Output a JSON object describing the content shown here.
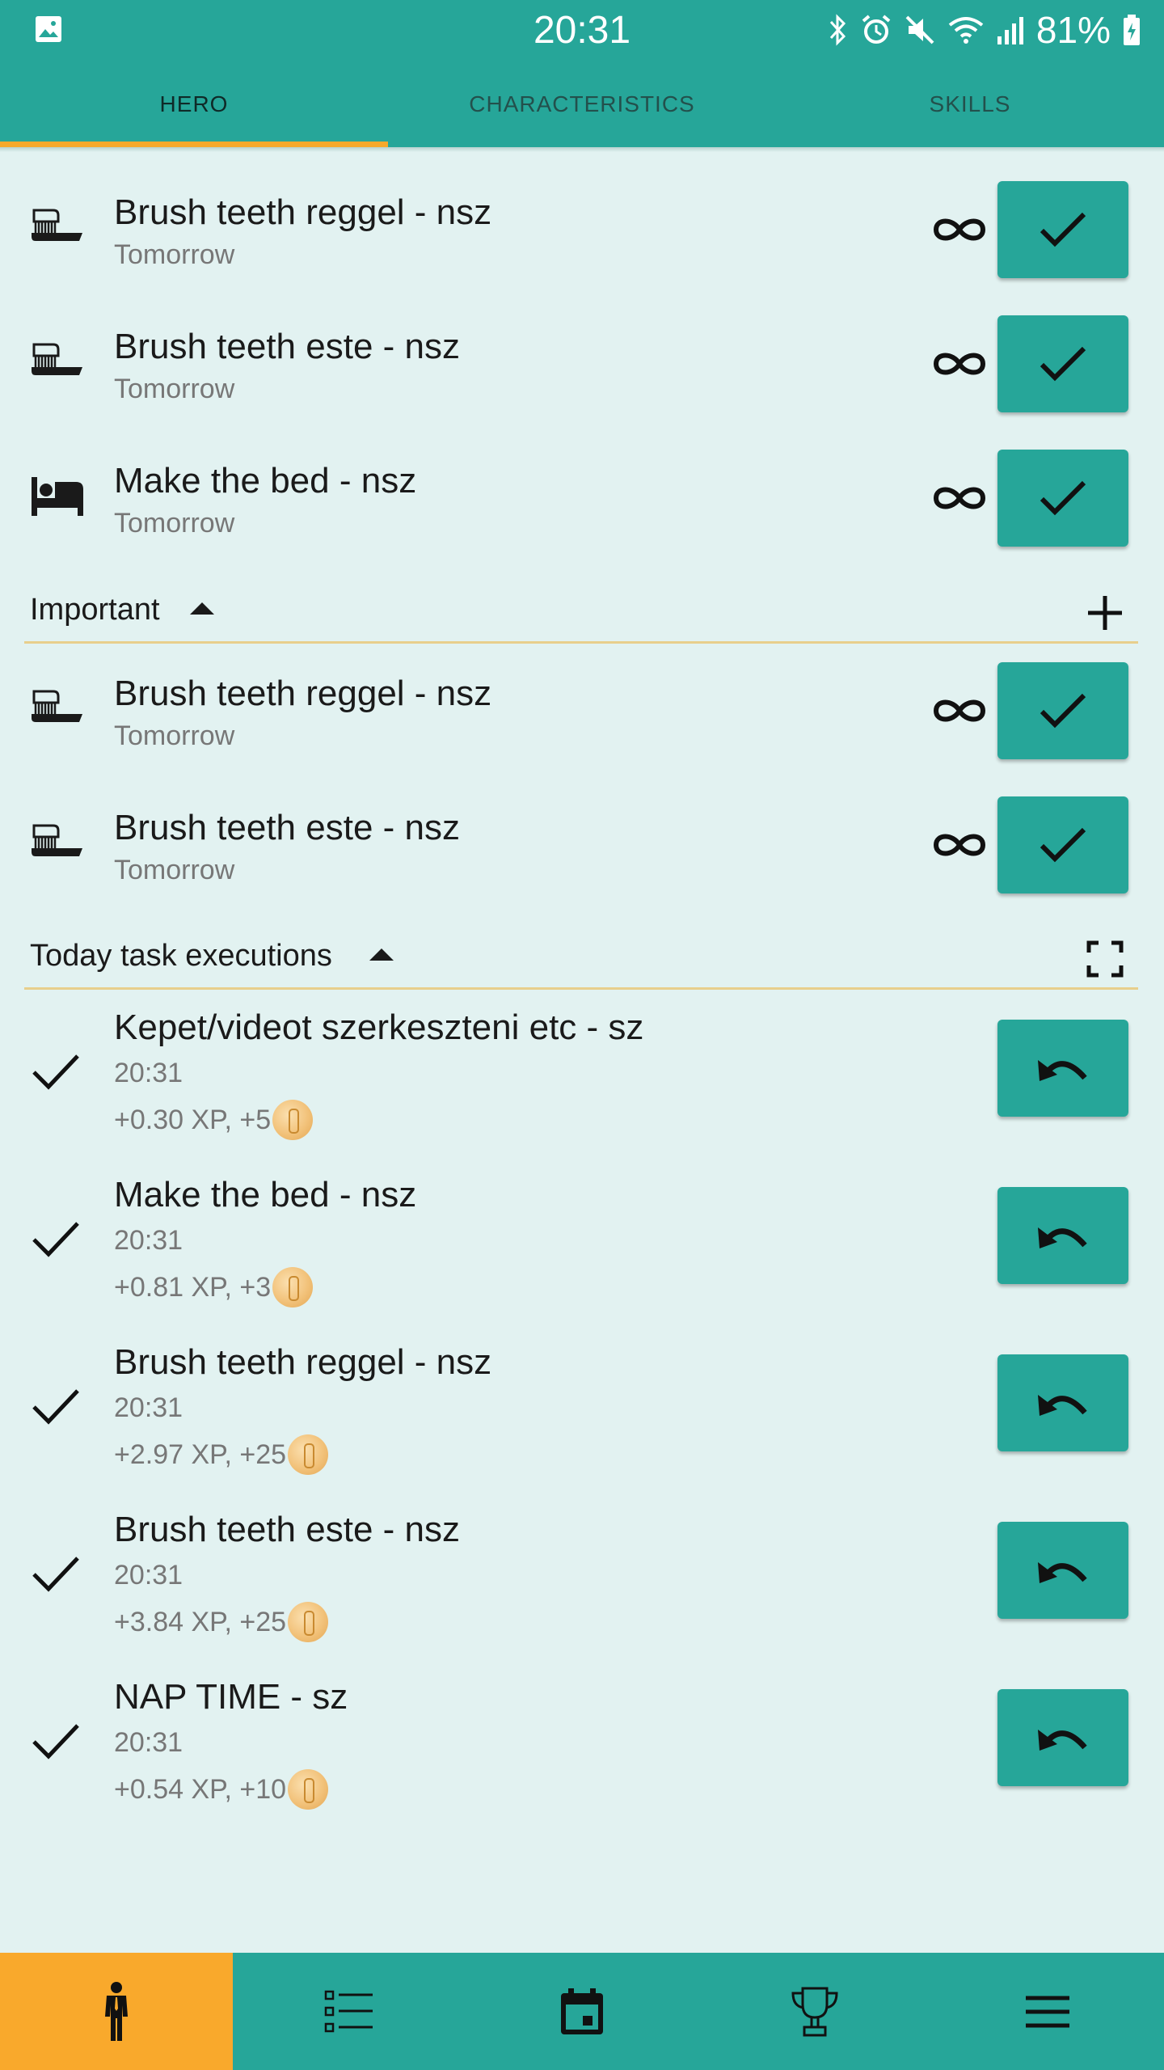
{
  "status_bar": {
    "time": "20:31",
    "battery": "81%",
    "icons": [
      "gallery-icon",
      "bluetooth-icon",
      "alarm-icon",
      "mute-icon",
      "wifi-icon",
      "signal-icon",
      "battery-icon"
    ]
  },
  "tabs": [
    {
      "label": "HERO",
      "active": true
    },
    {
      "label": "CHARACTERISTICS",
      "active": false
    },
    {
      "label": "SKILLS",
      "active": false
    }
  ],
  "tasks": [
    {
      "title": "Brush teeth reggel - nsz",
      "sub": "Tomorrow",
      "icon": "toothbrush-icon"
    },
    {
      "title": "Brush teeth este - nsz",
      "sub": "Tomorrow",
      "icon": "toothbrush-icon"
    },
    {
      "title": "Make the bed - nsz",
      "sub": "Tomorrow",
      "icon": "bed-icon"
    }
  ],
  "important": {
    "title": "Important",
    "tasks": [
      {
        "title": "Brush teeth reggel - nsz",
        "sub": "Tomorrow",
        "icon": "toothbrush-icon"
      },
      {
        "title": "Brush teeth este - nsz",
        "sub": "Tomorrow",
        "icon": "toothbrush-icon"
      }
    ]
  },
  "executions": {
    "title": "Today task executions",
    "items": [
      {
        "title": "Kepet/videot szerkeszteni etc - sz",
        "time": "20:31",
        "reward": "+0.30 XP, +5"
      },
      {
        "title": "Make the bed - nsz",
        "time": "20:31",
        "reward": "+0.81 XP, +3"
      },
      {
        "title": "Brush teeth reggel - nsz",
        "time": "20:31",
        "reward": "+2.97 XP, +25"
      },
      {
        "title": "Brush teeth este - nsz",
        "time": "20:31",
        "reward": "+3.84 XP, +25"
      },
      {
        "title": "NAP TIME - sz",
        "time": "20:31",
        "reward": "+0.54 XP, +10"
      }
    ]
  },
  "bottom_nav": [
    {
      "icon": "hero-icon",
      "active": true
    },
    {
      "icon": "task-list-icon",
      "active": false
    },
    {
      "icon": "calendar-icon",
      "active": false
    },
    {
      "icon": "trophy-icon",
      "active": false
    },
    {
      "icon": "menu-icon",
      "active": false
    }
  ],
  "colors": {
    "primary": "#26a699",
    "accent": "#f9a92c",
    "background": "#e2f2f1",
    "divider": "#e8cf8c"
  }
}
